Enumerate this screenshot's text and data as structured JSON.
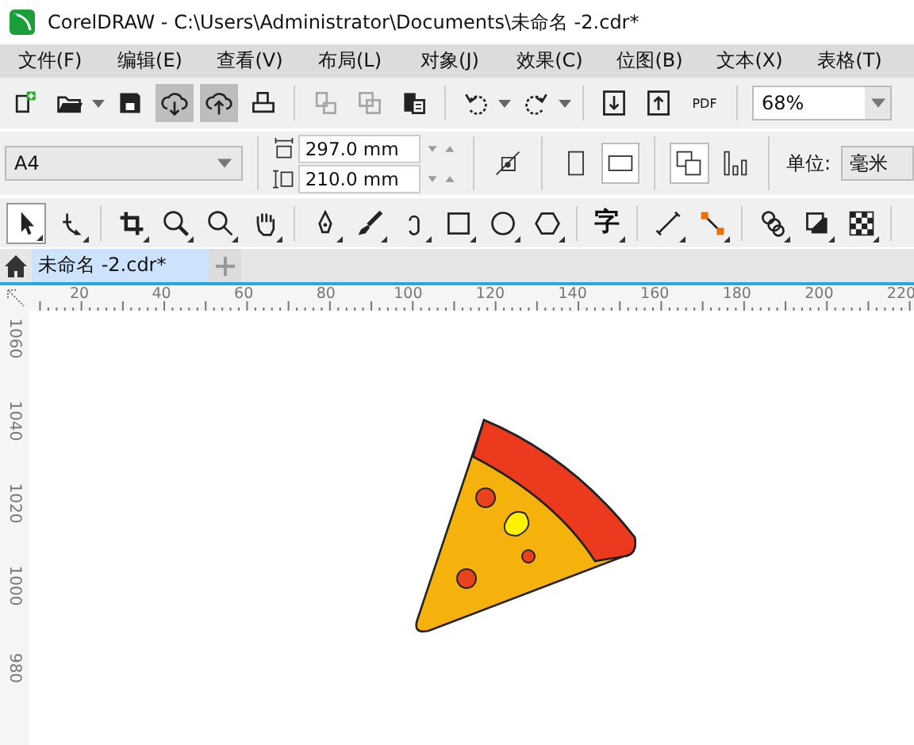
{
  "window": {
    "title": "CorelDRAW - C:\\Users\\Administrator\\Documents\\未命名 -2.cdr*"
  },
  "menu": [
    "文件(F)",
    "编辑(E)",
    "查看(V)",
    "布局(L)",
    "对象(J)",
    "效果(C)",
    "位图(B)",
    "文本(X)",
    "表格(T)"
  ],
  "standard_toolbar": {
    "buttons": [
      {
        "active": false,
        "disabled": false,
        "dropdown": false
      },
      {
        "active": false,
        "disabled": false,
        "dropdown": true
      },
      {
        "active": false,
        "disabled": false,
        "dropdown": false
      },
      {
        "active": true,
        "disabled": false,
        "dropdown": false
      },
      {
        "active": true,
        "disabled": false,
        "dropdown": false
      },
      {
        "active": false,
        "disabled": false,
        "dropdown": false
      },
      {
        "active": false,
        "disabled": true,
        "dropdown": false
      },
      {
        "active": false,
        "disabled": true,
        "dropdown": false
      },
      {
        "active": false,
        "disabled": false,
        "dropdown": false
      },
      {
        "active": false,
        "disabled": false,
        "dropdown": true
      },
      {
        "active": false,
        "disabled": false,
        "dropdown": true
      },
      {
        "active": false,
        "disabled": false,
        "dropdown": false
      },
      {
        "active": false,
        "disabled": false,
        "dropdown": false
      }
    ],
    "pdf_label": "PDF",
    "zoom": "68%"
  },
  "property_bar": {
    "page_size": "A4",
    "width": "297.0 mm",
    "height": "210.0 mm",
    "orientation": [
      {
        "selected": false
      },
      {
        "selected": true
      }
    ],
    "page_modes": [
      {
        "selected": true
      },
      {
        "selected": false
      }
    ],
    "units_label": "单位:",
    "units": "毫米"
  },
  "toolbox": {
    "tools": [
      {
        "selected": true
      },
      {
        "selected": false
      },
      {
        "selected": false
      },
      {
        "selected": false
      },
      {
        "selected": false
      },
      {
        "selected": false
      },
      {
        "selected": false
      },
      {
        "selected": false
      },
      {
        "selected": false
      },
      {
        "selected": false
      },
      {
        "selected": false
      },
      {
        "selected": false
      },
      {
        "selected": false
      },
      {
        "selected": false
      },
      {
        "selected": false
      },
      {
        "selected": false
      },
      {
        "selected": false
      },
      {
        "selected": false
      }
    ],
    "text_tool_glyph": "字"
  },
  "document_tabs": [
    {
      "label": "未命名 -2.cdr*",
      "selected": true
    }
  ],
  "rulers": {
    "horizontal": [
      "20",
      "40",
      "60",
      "80",
      "100",
      "120",
      "140",
      "160",
      "180",
      "200",
      "220"
    ],
    "vertical": [
      "1060",
      "1040",
      "1020",
      "1000",
      "980"
    ]
  }
}
